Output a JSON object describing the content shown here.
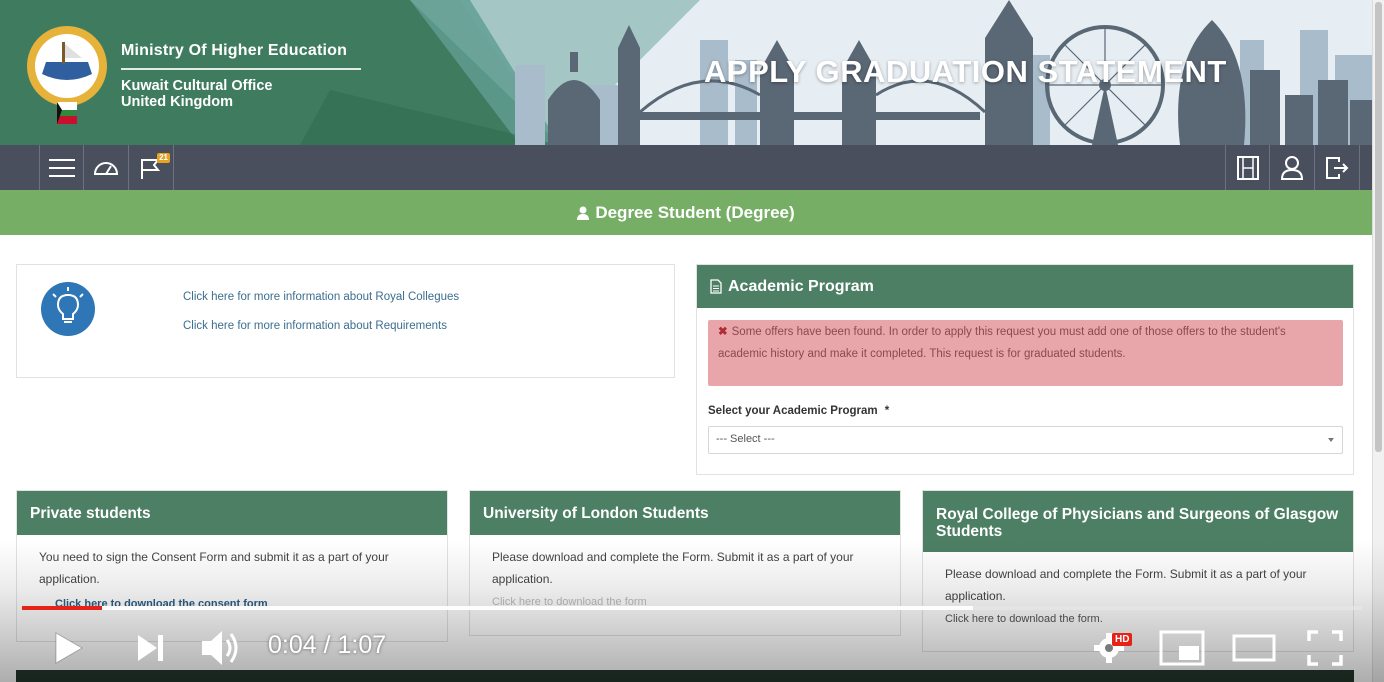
{
  "banner": {
    "ministry": "Ministry Of Higher Education",
    "office_line1": "Kuwait Cultural Office",
    "office_line2": "United Kingdom",
    "heading": "APPLY GRADUATION STATEMENT"
  },
  "toolbar": {
    "left_icons": [
      "menu-icon",
      "dashboard-icon",
      "flag-icon"
    ],
    "flag_badge": "21",
    "right_icons": [
      "film-icon",
      "user-icon",
      "logout-icon"
    ]
  },
  "role": {
    "label": "Degree Student (Degree)",
    "icon": "user-icon"
  },
  "info": {
    "icon": "lightbulb-icon",
    "link_royal_colleges": "Click here for more information about Royal Collegues",
    "link_requirements": "Click here for more information about Requirements"
  },
  "academic_program": {
    "title": "Academic Program",
    "alert_text": "Some offers have been found. In order to apply this request you must add one of those offers to the student's academic history and make it completed. This request is for graduated students.",
    "select_label": "Select your Academic Program",
    "required_mark": "*",
    "select_value": "--- Select ---"
  },
  "cards": [
    {
      "title": "Private students",
      "body": "You need to sign the Consent Form and submit it as a part of your application.",
      "link": "Click here to download the consent form"
    },
    {
      "title": "University of London Students",
      "body": "Please download and complete the Form. Submit it as a part of your application.",
      "link": "Click here to download the form"
    },
    {
      "title": "Royal College of Physicians and Surgeons of Glasgow Students",
      "body": "Please download and complete the Form. Submit it as a part of your application.",
      "link": "Click here to download the form."
    }
  ],
  "player": {
    "time_current": "0:04",
    "time_separator": "/",
    "time_total": "1:07",
    "hd_label": "HD",
    "played_fraction": 0.06,
    "buffered_fraction": 0.71,
    "progress_color": "#e62117"
  },
  "colors": {
    "toolbar": "#4a4f5d",
    "rolebar": "#76ae66",
    "panel_head": "#4d7f64",
    "alert_bg": "#e9a6aa"
  }
}
